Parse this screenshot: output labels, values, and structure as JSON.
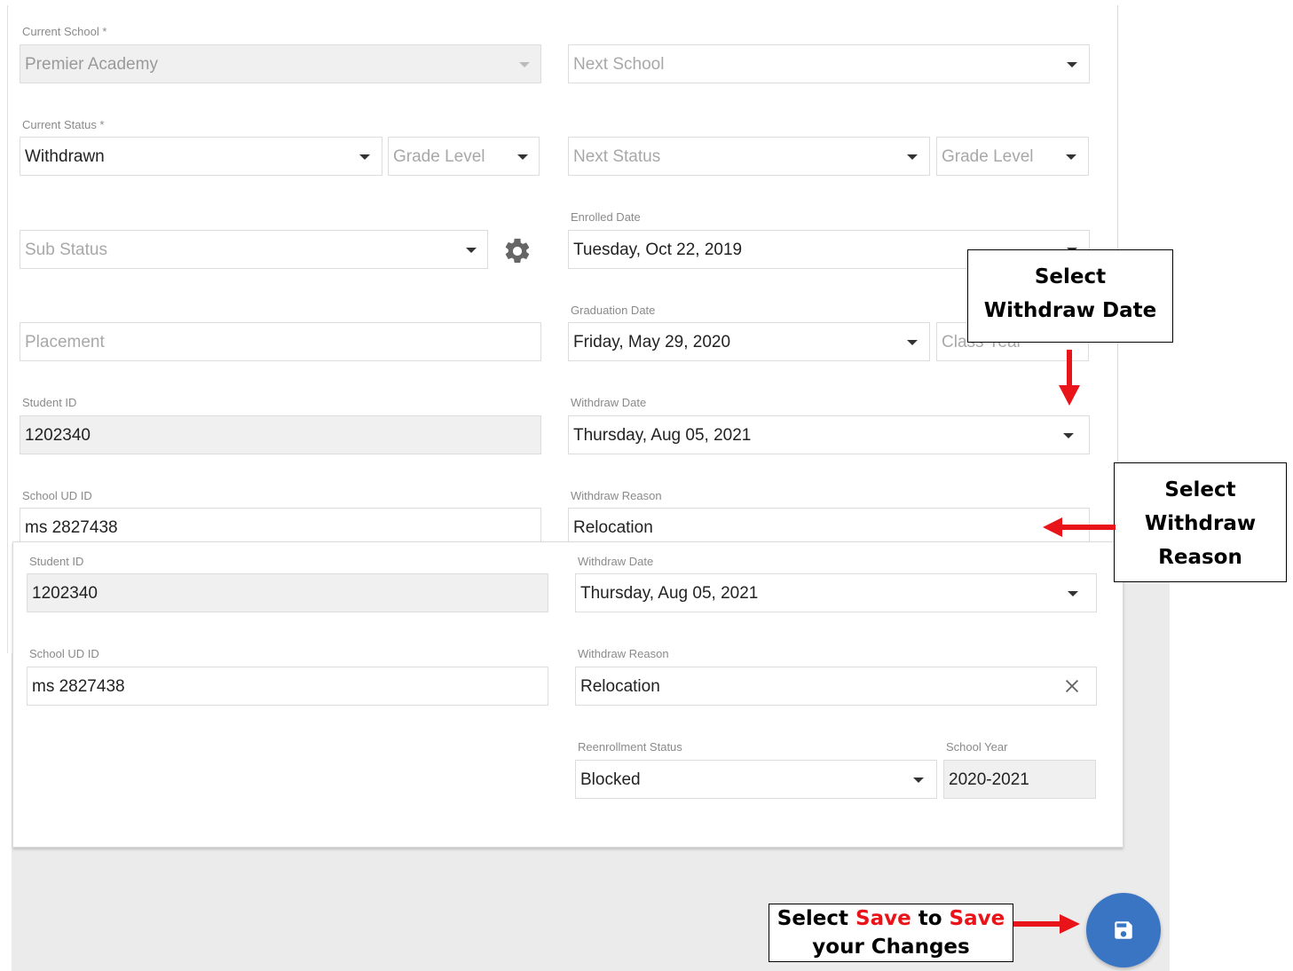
{
  "form_top": {
    "current_school": {
      "label": "Current School *",
      "value": "Premier Academy"
    },
    "next_school": {
      "placeholder": "Next School"
    },
    "current_status": {
      "label": "Current Status *",
      "value": "Withdrawn"
    },
    "grade_level_current": {
      "placeholder": "Grade Level"
    },
    "next_status": {
      "placeholder": "Next Status"
    },
    "grade_level_next": {
      "placeholder": "Grade Level"
    },
    "sub_status": {
      "placeholder": "Sub Status"
    },
    "enrolled_date": {
      "label": "Enrolled Date",
      "value": "Tuesday, Oct 22, 2019"
    },
    "placement": {
      "placeholder": "Placement"
    },
    "graduation_date": {
      "label": "Graduation Date",
      "value": "Friday, May 29, 2020"
    },
    "class_year": {
      "placeholder": "Class Year"
    },
    "student_id": {
      "label": "Student ID",
      "value": "1202340"
    },
    "withdraw_date": {
      "label": "Withdraw Date",
      "value": "Thursday, Aug 05, 2021"
    },
    "school_ud_id": {
      "label": "School UD ID",
      "value": "ms 2827438"
    },
    "withdraw_reason": {
      "label": "Withdraw Reason",
      "value": "Relocation"
    }
  },
  "form_bottom": {
    "student_id": {
      "label": "Student ID",
      "value": "1202340"
    },
    "withdraw_date": {
      "label": "Withdraw Date",
      "value": "Thursday, Aug 05, 2021"
    },
    "school_ud_id": {
      "label": "School UD ID",
      "value": "ms 2827438"
    },
    "withdraw_reason": {
      "label": "Withdraw Reason",
      "value": "Relocation"
    },
    "reenrollment_status": {
      "label": "Reenrollment Status",
      "value": "Blocked"
    },
    "school_year": {
      "label": "School Year",
      "value": "2020-2021"
    }
  },
  "callouts": {
    "withdraw_date": {
      "line1": "Select",
      "line2": "Withdraw Date"
    },
    "withdraw_reason": {
      "line1": "Select",
      "line2": "Withdraw",
      "line3": "Reason"
    },
    "save": {
      "w1": "Select ",
      "w2": "Save",
      "w3": " to ",
      "w4": "Save",
      "line2": "your Changes"
    }
  },
  "colors": {
    "accent_red": "#e8141a",
    "fab_blue": "#3a75c4"
  },
  "icons": {
    "save": "floppy-disk-icon",
    "settings": "gear-icon",
    "clear": "close-icon"
  }
}
